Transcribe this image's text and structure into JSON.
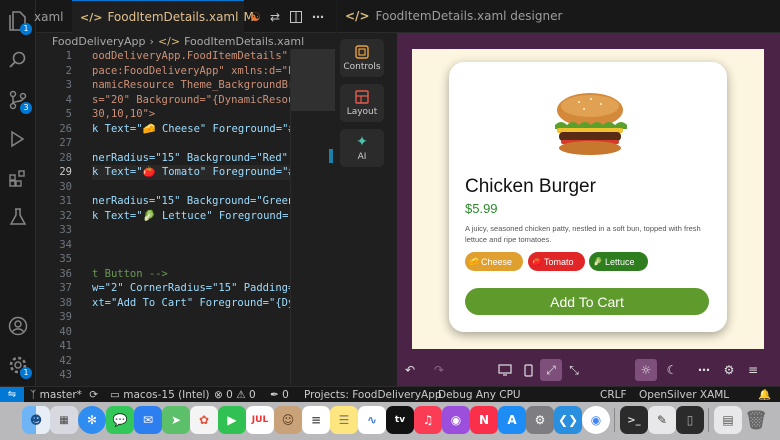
{
  "activity_bar": {
    "items": [
      {
        "name": "explorer",
        "badge": "1"
      },
      {
        "name": "search",
        "badge": ""
      },
      {
        "name": "source-control",
        "badge": "3"
      },
      {
        "name": "run-debug",
        "badge": ""
      },
      {
        "name": "extensions",
        "badge": ""
      },
      {
        "name": "testing",
        "badge": ""
      }
    ],
    "bottom": [
      {
        "name": "accounts",
        "badge": ""
      },
      {
        "name": "settings",
        "badge": "1"
      }
    ]
  },
  "editor": {
    "prev_tab_fragment": "xaml",
    "active_tab": {
      "label": "FoodItemDetails.xaml",
      "status": "M"
    },
    "breadcrumb": [
      "FoodDeliveryApp",
      "FoodItemDetails.xaml"
    ],
    "line_numbers": [
      "1",
      "2",
      "3",
      "4",
      "5",
      "26",
      "27",
      "28",
      "29",
      "30",
      "31",
      "32",
      "33",
      "34",
      "35",
      "36",
      "37",
      "38",
      "39",
      "40",
      "41",
      "42",
      "43"
    ],
    "current_line": "29",
    "code_lines": [
      "oodDeliveryApp.FoodItemDetails\"",
      "pace:FoodDeliveryApp\" xmlns:d=\"htt",
      "namicResource Theme_BackgroundBrus",
      "s=\"20\" Background=\"{DynamicResourc",
      "30,10,10\">",
      "k Text=\"🧀 Cheese\" Foreground=\"#FF",
      "",
      "nerRadius=\"15\" Background=\"Red\" Pa",
      "k Text=\"🍅 Tomato\" Foreground=\"#FF",
      "",
      "nerRadius=\"15\" Background=\"Green\"",
      "k Text=\"🥬 Lettuce\" Foreground=\"#F",
      "",
      "",
      "",
      "t Button -->",
      "w=\"2\" CornerRadius=\"15\" Padding=\"5",
      "xt=\"Add To Cart\" Foreground=\"{Dyna",
      "",
      "",
      "",
      "",
      ""
    ]
  },
  "designer": {
    "tab_label": "FoodItemDetails.xaml designer",
    "tools": [
      {
        "label": "Controls"
      },
      {
        "label": "Layout"
      },
      {
        "label": "AI"
      }
    ],
    "card": {
      "name": "Chicken Burger",
      "price": "$5.99",
      "description": "A juicy, seasoned chicken patty, nestled in a soft bun, topped with fresh lettuce and ripe tomatoes.",
      "ingredients": [
        {
          "label": "Cheese",
          "emoji": "🧀",
          "color": "#e0a030"
        },
        {
          "label": "Tomato",
          "emoji": "🍅",
          "color": "#e02626"
        },
        {
          "label": "Lettuce",
          "emoji": "🥬",
          "color": "#2e7d1e"
        }
      ],
      "button_label": "Add To Cart",
      "button_color": "#5e9a2c"
    },
    "canvas_background": "#4a2347"
  },
  "status_bar": {
    "branch": "master*",
    "target": "macos-15 (Intel)",
    "errors": "0",
    "warnings": "0",
    "ports": "0",
    "project": "Projects: FoodDeliveryApp",
    "config": "Debug Any CPU",
    "line_ending": "CRLF",
    "extension": "OpenSilver XAML"
  },
  "dock": {
    "apps": [
      "finder",
      "launchpad",
      "safari",
      "messages",
      "mail",
      "maps",
      "photos",
      "facetime",
      "calendar",
      "contacts",
      "reminders",
      "notes",
      "freeform",
      "tv",
      "music",
      "podcasts",
      "news",
      "app-store",
      "system-settings",
      "vscode",
      "chrome",
      "terminal",
      "script-editor",
      "xcode-simulator"
    ]
  }
}
